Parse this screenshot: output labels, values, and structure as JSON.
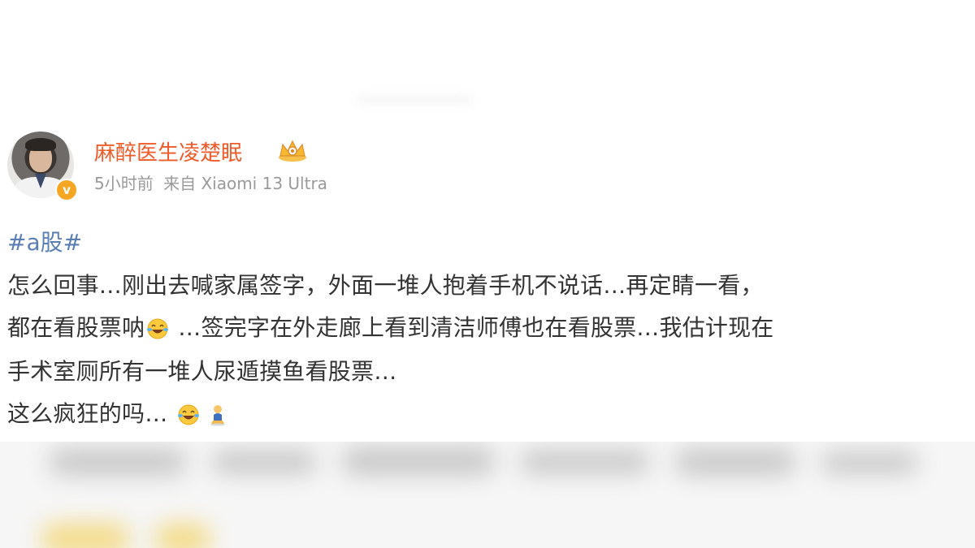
{
  "post": {
    "username": "麻醉医生凌楚眠",
    "time": "5小时前",
    "source_prefix": "来自",
    "source_device": "Xiaomi 13 Ultra",
    "verified_badge": "v",
    "hashtag": "#a股#",
    "line1": "怎么回事…刚出去喊家属签字，外面一堆人抱着手机不说话…再定睛一看，",
    "line2_pre": "都在看股票呐",
    "line2_post": " …签完字在外走廊上看到清洁师傅也在看股票…我估计现在",
    "line3": "手术室厕所有一堆人尿遁摸鱼看股票…",
    "line4": "这么疯狂的吗…"
  },
  "icons": {
    "badge": "crown-icon",
    "laugh": "laughing-tears-emoji-icon",
    "figure": "kneeling-figure-emoji-icon"
  },
  "colors": {
    "username": "#f05a28",
    "hashtag": "#5b7fb5",
    "text": "#333333",
    "meta": "#9a9a9a",
    "verified": "#f5a623"
  }
}
